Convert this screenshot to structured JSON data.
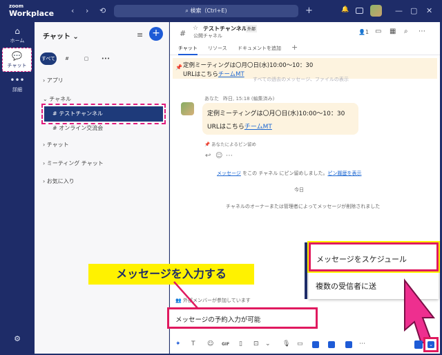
{
  "app": {
    "brand_small": "zoom",
    "brand_big": "Workplace"
  },
  "titlebar": {
    "search_label": "検索（Ctrl+E)",
    "back": "‹",
    "forward": "›",
    "history": "⟲",
    "plus": "+",
    "bell": "🔔",
    "minimize": "—",
    "maximize": "▢",
    "close": "✕"
  },
  "rail": {
    "home": "ホーム",
    "chat": "チャット",
    "more": "詳細",
    "settings": "⚙"
  },
  "chatpanel": {
    "title": "チャット ⌄",
    "filters": [
      "すべて",
      "#",
      "▢",
      "•••"
    ],
    "sections": {
      "apps": "アプリ",
      "channels": "チャネル",
      "chat": "チャット",
      "meeting_chat": "ミーティング チャット",
      "favorites": "お気に入り"
    },
    "channels": [
      "テストチャンネル",
      "オンライン交流会"
    ]
  },
  "header": {
    "channel_name": "テストチャンネル",
    "external_badge": "外部",
    "channel_type": "公開チャネル",
    "member_count": "1",
    "tabs": [
      "チャット",
      "リソース",
      "ドキュメントを追加"
    ],
    "add_tab": "+"
  },
  "pinned": {
    "line1": "定例ミーティングは〇月〇日(水)10:00～10：30",
    "line2_prefix": "URLはこちら",
    "line2_link": "チームMT"
  },
  "faded_line": "すべての過去のメッセージ、ファイルの表示",
  "message": {
    "author": "あなた",
    "time": "昨日, 15:18 (編集済み)",
    "line1": "定例ミーティングは〇月〇日(水)10:00～10：30",
    "line2_prefix": "URLはこちら",
    "line2_link": "チームMT",
    "pin_note": "あなたによるピン留め"
  },
  "system": {
    "pin_notice_prefix": "メッセージ",
    "pin_notice_middle": " をこの チャネル にピン留めしました。",
    "pin_history": "ピン履歴を表示",
    "today": "今日",
    "deleted_notice": "チャネルのオーナーまたは管理者によってメッセージが削除されました"
  },
  "callout": {
    "text": "メッセージを入力する"
  },
  "composer": {
    "external_notice": "外部メンバーが参加しています",
    "input_text": "メッセージの予約入力が可能"
  },
  "menu": {
    "schedule": "メッセージをスケジュール",
    "multi": "複数の受信者に送"
  },
  "toolbar": {
    "gif": "GIF",
    "send_dropdown": "⌄"
  },
  "colors": {
    "brand": "#1e2c68",
    "highlight": "#e0195f",
    "callout": "#fff200",
    "pin_bg": "#fdf3df"
  }
}
